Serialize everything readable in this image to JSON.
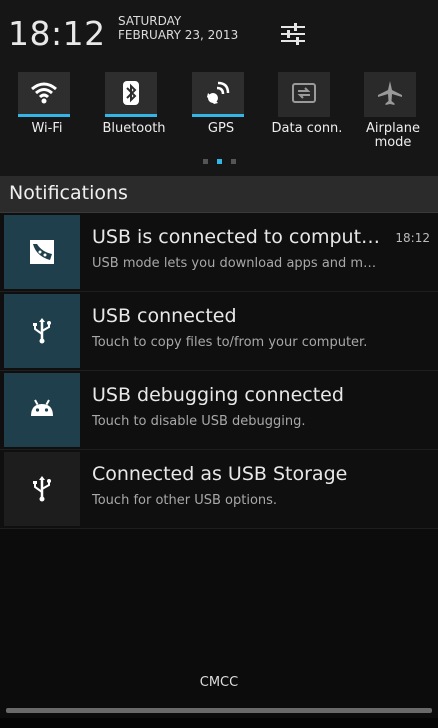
{
  "status": {
    "time": "18:12",
    "weekday": "SATURDAY",
    "date": "FEBRUARY 23, 2013",
    "settings_icon": "sliders-icon"
  },
  "quick_settings": [
    {
      "label": "Wi-Fi",
      "icon": "wifi-icon",
      "enabled": true
    },
    {
      "label": "Bluetooth",
      "icon": "bluetooth-icon",
      "enabled": true
    },
    {
      "label": "GPS",
      "icon": "gps-icon",
      "enabled": true
    },
    {
      "label": "Data conn.",
      "icon": "data-connection-icon",
      "enabled": false
    },
    {
      "label": "Airplane mode",
      "icon": "airplane-icon",
      "enabled": false
    }
  ],
  "page_indicator": {
    "count": 3,
    "active": 1
  },
  "notifications_header": "Notifications",
  "notifications": [
    {
      "title": "USB is connected to comput…",
      "subtitle": "USB mode lets you download apps and m…",
      "time": "18:12",
      "icon": "usb-app-icon"
    },
    {
      "title": "USB connected",
      "subtitle": "Touch to copy files to/from your computer.",
      "time": "",
      "icon": "usb-icon"
    },
    {
      "title": "USB debugging connected",
      "subtitle": "Touch to disable USB debugging.",
      "time": "",
      "icon": "android-icon"
    },
    {
      "title": "Connected as USB Storage",
      "subtitle": "Touch for other USB options.",
      "time": "",
      "icon": "usb-icon"
    }
  ],
  "carrier": "CMCC",
  "colors": {
    "accent": "#33b5e5",
    "background": "#0c0c0c",
    "highlight_icon_bg": "#1f3f4c"
  }
}
